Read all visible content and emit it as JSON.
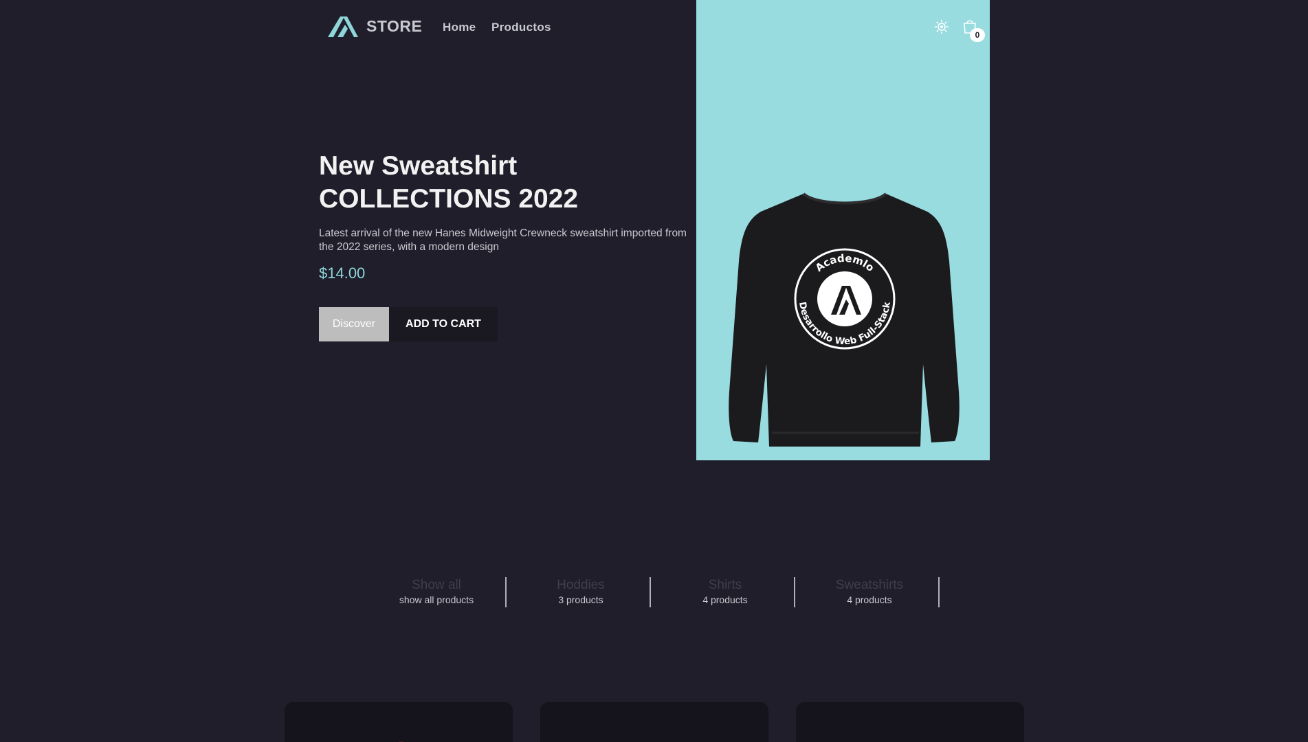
{
  "header": {
    "brand": "STORE",
    "nav": [
      {
        "label": "Home"
      },
      {
        "label": "Productos"
      }
    ],
    "icons": [
      "logo-icon",
      "theme-toggle-icon",
      "cart-icon"
    ],
    "cart_count": "0"
  },
  "hero": {
    "title_line1": "New Sweatshirt",
    "title_line2": "COLLECTIONS 2022",
    "description": "Latest arrival of the new Hanes Midweight Crewneck sweatshirt imported from the 2022 series, with a modern design",
    "price": "$14.00",
    "discover_label": "Discover",
    "add_to_cart_label": "ADD TO CART",
    "print_top_text": "Academlo",
    "print_bottom_text": "Desarrollo Web Full-Stack",
    "image_background": "#98dce0"
  },
  "categories": [
    {
      "name": "Show all",
      "count": "show all products"
    },
    {
      "name": "Hoddies",
      "count": "3 products"
    },
    {
      "name": "Shirts",
      "count": "4 products"
    },
    {
      "name": "Sweatshirts",
      "count": "4 products"
    }
  ],
  "colors": {
    "background": "#1f1e2a",
    "accent": "#8fd6db",
    "card": "#15141c"
  }
}
